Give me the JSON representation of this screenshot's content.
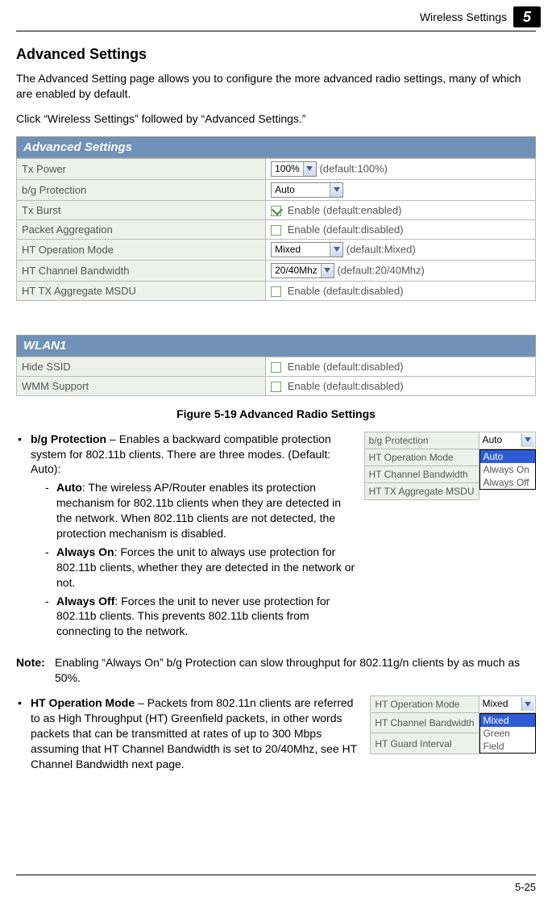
{
  "header": {
    "section": "Wireless Settings",
    "chapter": "5"
  },
  "page": {
    "heading": "Advanced Settings",
    "intro": "The Advanced Setting page allows you to configure the more advanced radio settings, many of which are enabled by default.",
    "nav_instruction": "Click “Wireless Settings” followed by “Advanced Settings.”"
  },
  "panel1": {
    "title": "Advanced Settings",
    "rows": {
      "tx_power": {
        "label": "Tx Power",
        "value": "100%",
        "hint": "(default:100%)"
      },
      "bg_protection": {
        "label": "b/g Protection",
        "value": "Auto"
      },
      "tx_burst": {
        "label": "Tx Burst",
        "checked": true,
        "text": "Enable (default:enabled)"
      },
      "packet_agg": {
        "label": "Packet Aggregation",
        "checked": false,
        "text": "Enable (default:disabled)"
      },
      "ht_op_mode": {
        "label": "HT Operation Mode",
        "value": "Mixed",
        "hint": "(default:Mixed)"
      },
      "ht_channel_bw": {
        "label": "HT Channel Bandwidth",
        "value": "20/40Mhz",
        "hint": "(default:20/40Mhz)"
      },
      "ht_tx_agg": {
        "label": "HT TX Aggregate MSDU",
        "checked": false,
        "text": "Enable (default:disabled)"
      }
    }
  },
  "panel2": {
    "title": "WLAN1",
    "rows": {
      "hide_ssid": {
        "label": "Hide SSID",
        "checked": false,
        "text": "Enable (default:disabled)"
      },
      "wmm": {
        "label": "WMM Support",
        "checked": false,
        "text": "Enable (default:disabled)"
      }
    }
  },
  "figure_caption": "Figure 5-19  Advanced Radio Settings",
  "inset1": {
    "rows": [
      "b/g Protection",
      "HT Operation Mode",
      "HT Channel Bandwidth",
      "HT TX Aggregate MSDU"
    ],
    "select_value": "Auto",
    "options": [
      "Auto",
      "Always On",
      "Always Off"
    ],
    "selected": "Auto"
  },
  "bullet_bg": {
    "title": "b/g Protection",
    "text": " – Enables a backward compatible protection system for 802.11b clients. There are three modes. (Default: Auto):",
    "sub": {
      "auto": {
        "title": "Auto",
        "text": ": The wireless AP/Router enables its protection mechanism for 802.11b clients when they are detected in the network. When 802.11b clients are not detected, the protection mechanism is disabled."
      },
      "always_on": {
        "title": "Always On",
        "text": ": Forces the unit to always use protection for 802.11b clients, whether they are detected in the network or not."
      },
      "always_off": {
        "title": "Always Off",
        "text": ": Forces the unit to never use protection for 802.11b clients. This prevents 802.11b clients from connecting to the network."
      }
    }
  },
  "note": {
    "label": "Note:",
    "text": "Enabling “Always On” b/g Protection can slow throughput for 802.11g/n clients by as much as 50%."
  },
  "inset2": {
    "rows": [
      "HT Operation Mode",
      "HT Channel Bandwidth",
      "HT Guard Interval"
    ],
    "select_value": "Mixed",
    "options": [
      "Mixed",
      "Green Field"
    ],
    "selected": "Mixed"
  },
  "bullet_ht": {
    "title": "HT Operation Mode",
    "text": " – Packets from 802.11n clients are referred to as High Throughput (HT) Greenfield packets, in other words packets that can be transmitted at rates of up to 300 Mbps assuming that HT Channel Bandwidth is set to 20/40Mhz, see HT Channel Bandwidth next page."
  },
  "footer": "5-25"
}
